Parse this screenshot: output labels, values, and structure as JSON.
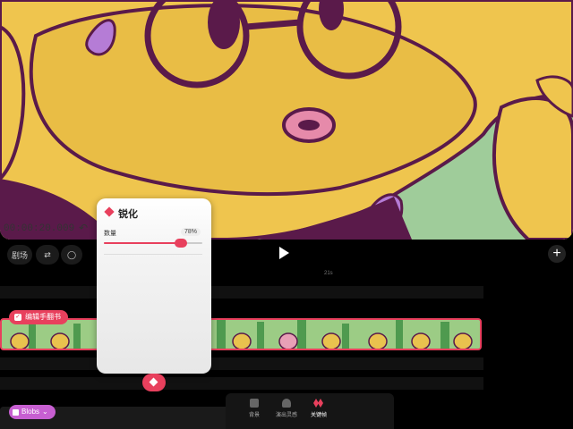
{
  "preview": {
    "timecode": "00:00:20.009"
  },
  "toolbar": {
    "items": [
      {
        "label": "剧场"
      },
      {
        "label": ""
      },
      {
        "label": ""
      }
    ]
  },
  "ruler": {
    "labels": [
      "21s"
    ]
  },
  "clip": {
    "label": "编辑手翻书"
  },
  "popup": {
    "title": "锐化",
    "amount_label": "数量",
    "amount_value": "78%",
    "amount": 0.78
  },
  "bottom_tabs": [
    {
      "label": "背景"
    },
    {
      "label": "演出灵感"
    },
    {
      "label": "关键帧"
    }
  ],
  "blobs": {
    "label": "Blobs"
  },
  "colors": {
    "accent": "#e8405d",
    "blobs": "#c75fd1",
    "character": "#efc54e",
    "outline": "#5a1a4a",
    "background": "#9fcc9a"
  }
}
